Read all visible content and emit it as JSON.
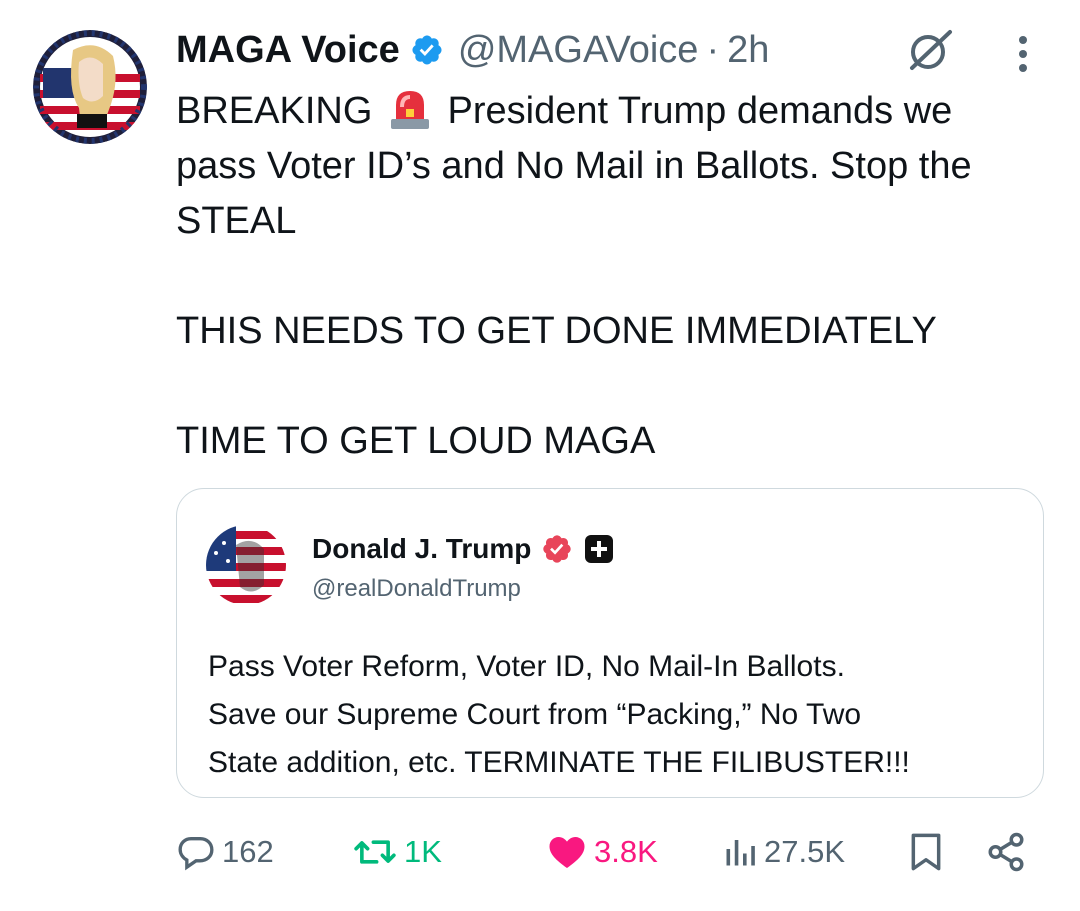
{
  "author": {
    "name": "MAGA Voice",
    "handle": "@MAGAVoice",
    "separator": "·",
    "time": "2h"
  },
  "tweet": {
    "line1_before": "BREAKING ",
    "line1_after": " President Trump demands we pass Voter ID’s and No Mail in Ballots. Stop the STEAL\n\nTHIS NEEDS TO GET DONE IMMEDIATELY\n\nTIME TO GET LOUD MAGA"
  },
  "quote": {
    "name": "Donald J. Trump",
    "handle": "@realDonaldTrump",
    "text": "Pass Voter Reform, Voter ID, No Mail-In Ballots.\nSave our Supreme Court from “Packing,” No Two\nState addition, etc. TERMINATE THE FILIBUSTER!!!"
  },
  "actions": {
    "replies": "162",
    "retweets": "1K",
    "likes": "3.8K",
    "views": "27.5K"
  },
  "icons": {
    "verified": "verified-badge-icon",
    "grok": "grok-icon",
    "more": "more-icon",
    "siren": "siren-emoji-icon",
    "reply": "reply-icon",
    "retweet": "retweet-icon",
    "like": "heart-icon",
    "views": "views-icon",
    "bookmark": "bookmark-icon",
    "share": "share-icon"
  },
  "colors": {
    "blue": "#1d9bf0",
    "green": "#00ba7c",
    "pink": "#f91880",
    "gray": "#536471",
    "border": "#cfd9de"
  }
}
